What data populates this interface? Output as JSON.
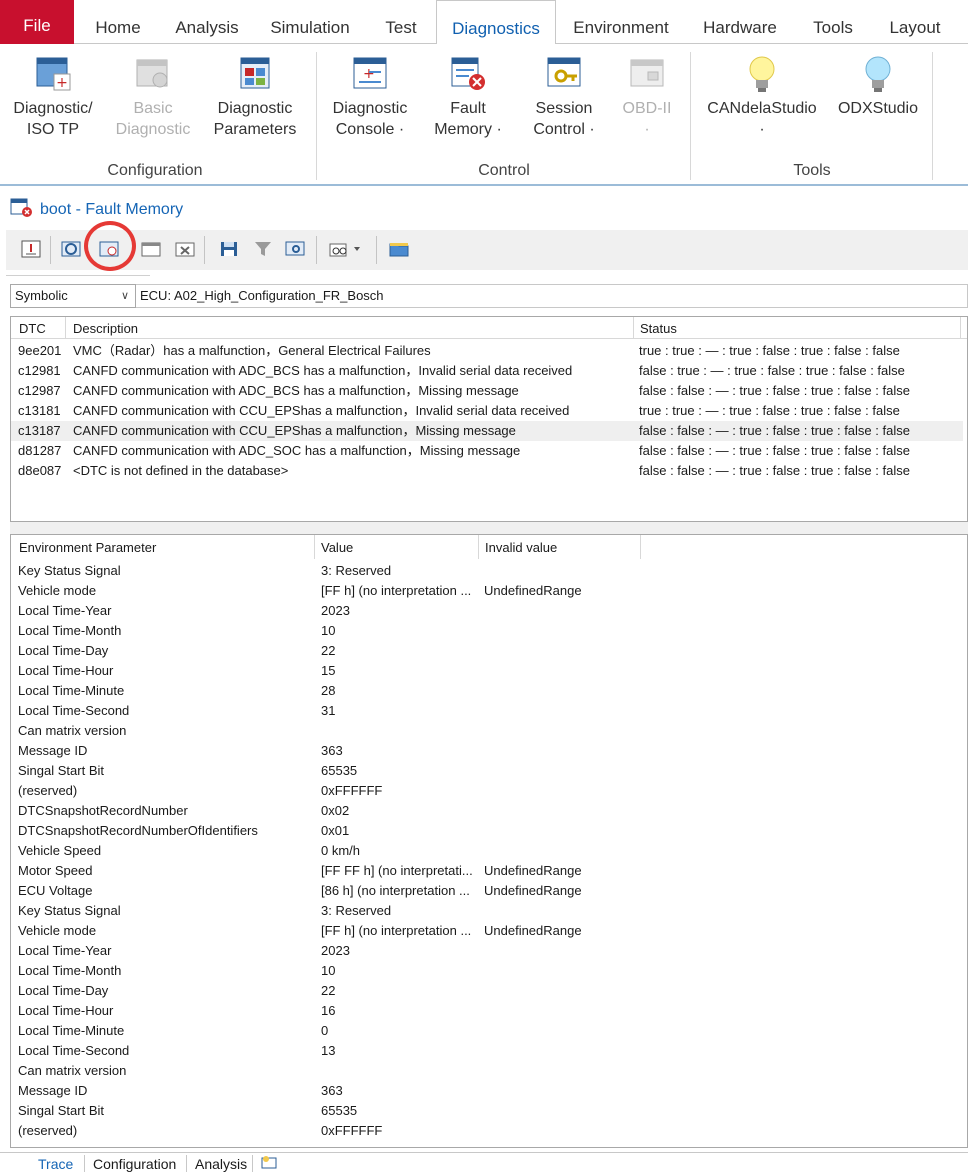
{
  "ribbon_tabs": [
    {
      "label": "File"
    },
    {
      "label": "Home"
    },
    {
      "label": "Analysis"
    },
    {
      "label": "Simulation"
    },
    {
      "label": "Test"
    },
    {
      "label": "Diagnostics"
    },
    {
      "label": "Environment"
    },
    {
      "label": "Hardware"
    },
    {
      "label": "Tools"
    },
    {
      "label": "Layout"
    }
  ],
  "active_tab": "Diagnostics",
  "ribbon": {
    "configuration": {
      "label": "Configuration",
      "diag_iso_tp": {
        "line1": "Diagnostic/",
        "line2": "ISO TP"
      },
      "basic_diag": {
        "line1": "Basic",
        "line2": "Diagnostic"
      },
      "diag_params": {
        "line1": "Diagnostic",
        "line2": "Parameters"
      }
    },
    "control": {
      "label": "Control",
      "diag_console": {
        "line1": "Diagnostic",
        "line2": "Console ·"
      },
      "fault_memory": {
        "line1": "Fault",
        "line2": "Memory ·"
      },
      "session_control": {
        "line1": "Session",
        "line2": "Control ·"
      },
      "obd2": {
        "line1": "OBD-II",
        "line2": "·"
      }
    },
    "tools": {
      "label": "Tools",
      "candela": {
        "line1": "CANdelaStudio",
        "line2": "·"
      },
      "odx": {
        "line1": "ODXStudio"
      }
    }
  },
  "window": {
    "title": "boot - Fault Memory"
  },
  "filter": {
    "mode": "Symbolic",
    "ecu": "ECU: A02_High_Configuration_FR_Bosch"
  },
  "dtc_table": {
    "headers": {
      "dtc": "DTC",
      "description": "Description",
      "status": "Status"
    },
    "rows": [
      {
        "dtc": "9ee201",
        "description": "VMC（Radar）has a malfunction，General Electrical Failures",
        "status": "true : true : — : true : false : true : false : false"
      },
      {
        "dtc": "c12981",
        "description": "CANFD communication with ADC_BCS has a malfunction，Invalid serial data received",
        "status": "false : true : — : true : false : true : false : false"
      },
      {
        "dtc": "c12987",
        "description": "CANFD communication with ADC_BCS has a malfunction，Missing message",
        "status": "false : false : — : true : false : true : false : false"
      },
      {
        "dtc": "c13181",
        "description": "CANFD communication with CCU_EPShas a malfunction，Invalid serial data received",
        "status": "true : true : — : true : false : true : false : false"
      },
      {
        "dtc": "c13187",
        "description": "CANFD communication with CCU_EPShas a malfunction，Missing message",
        "status": "false : false : — : true : false : true : false : false"
      },
      {
        "dtc": "d81287",
        "description": "CANFD communication with ADC_SOC has a malfunction，Missing message",
        "status": "false : false : — : true : false : true : false : false"
      },
      {
        "dtc": "d8e087",
        "description": "<DTC is not defined in the database>",
        "status": "false : false : — : true : false : true : false : false"
      }
    ]
  },
  "env_table": {
    "headers": {
      "param": "Environment Parameter",
      "value": "Value",
      "invalid": "Invalid value"
    },
    "rows": [
      {
        "param": "Key Status Signal",
        "value": "3: Reserved",
        "invalid": ""
      },
      {
        "param": "Vehicle mode",
        "value": "[FF h] (no interpretation ...",
        "invalid": "UndefinedRange"
      },
      {
        "param": "Local Time-Year",
        "value": "2023",
        "invalid": ""
      },
      {
        "param": "Local Time-Month",
        "value": "10",
        "invalid": ""
      },
      {
        "param": "Local Time-Day",
        "value": "22",
        "invalid": ""
      },
      {
        "param": "Local Time-Hour",
        "value": "15",
        "invalid": ""
      },
      {
        "param": "Local Time-Minute",
        "value": "28",
        "invalid": ""
      },
      {
        "param": "Local Time-Second",
        "value": "31",
        "invalid": ""
      },
      {
        "param": "Can matrix version",
        "value": "",
        "invalid": ""
      },
      {
        "param": "Message ID",
        "value": "363",
        "invalid": ""
      },
      {
        "param": "Singal Start Bit",
        "value": "65535",
        "invalid": ""
      },
      {
        "param": "(reserved)",
        "value": "0xFFFFFF",
        "invalid": ""
      },
      {
        "param": "DTCSnapshotRecordNumber",
        "value": "0x02",
        "invalid": ""
      },
      {
        "param": "DTCSnapshotRecordNumberOfIdentifiers",
        "value": "0x01",
        "invalid": ""
      },
      {
        "param": "Vehicle Speed",
        "value": "0 km/h",
        "invalid": ""
      },
      {
        "param": "Motor Speed",
        "value": "[FF FF h] (no interpretati...",
        "invalid": "UndefinedRange"
      },
      {
        "param": "ECU Voltage",
        "value": "[86 h] (no interpretation ...",
        "invalid": "UndefinedRange"
      },
      {
        "param": "Key Status Signal",
        "value": "3: Reserved",
        "invalid": ""
      },
      {
        "param": "Vehicle mode",
        "value": "[FF h] (no interpretation ...",
        "invalid": "UndefinedRange"
      },
      {
        "param": "Local Time-Year",
        "value": "2023",
        "invalid": ""
      },
      {
        "param": "Local Time-Month",
        "value": "10",
        "invalid": ""
      },
      {
        "param": "Local Time-Day",
        "value": "22",
        "invalid": ""
      },
      {
        "param": "Local Time-Hour",
        "value": "16",
        "invalid": ""
      },
      {
        "param": "Local Time-Minute",
        "value": "0",
        "invalid": ""
      },
      {
        "param": "Local Time-Second",
        "value": "13",
        "invalid": ""
      },
      {
        "param": "Can matrix version",
        "value": "",
        "invalid": ""
      },
      {
        "param": "Message ID",
        "value": "363",
        "invalid": ""
      },
      {
        "param": "Singal Start Bit",
        "value": "65535",
        "invalid": ""
      },
      {
        "param": "(reserved)",
        "value": "0xFFFFFF",
        "invalid": ""
      }
    ]
  },
  "bottom_tabs": [
    {
      "label": "Trace"
    },
    {
      "label": "Configuration"
    },
    {
      "label": "Analysis"
    }
  ],
  "colors": {
    "file_tab": "#c8102e",
    "accent": "#1565b5",
    "highlight": "#e53935"
  }
}
